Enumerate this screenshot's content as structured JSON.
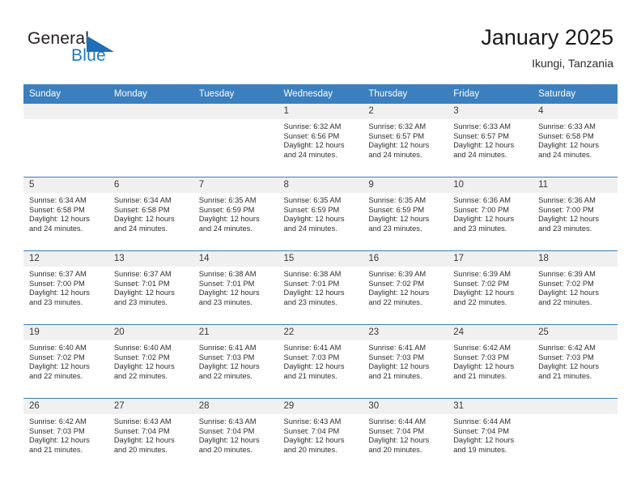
{
  "brand": {
    "name_part1": "General",
    "name_part2": "Blue",
    "triangle_color": "#1f6fb8",
    "blue_color": "#1f7ac4"
  },
  "header": {
    "title": "January 2025",
    "subtitle": "Ikungi, Tanzania"
  },
  "theme": {
    "header_row_bg": "#3b7fbf",
    "daynum_bg": "#f0f0f0",
    "grid_line": "#3b7fbf"
  },
  "weekdays": [
    "Sunday",
    "Monday",
    "Tuesday",
    "Wednesday",
    "Thursday",
    "Friday",
    "Saturday"
  ],
  "weeks": [
    [
      {
        "day": "",
        "sunrise": "",
        "sunset": "",
        "daylight": "",
        "daylight2": ""
      },
      {
        "day": "",
        "sunrise": "",
        "sunset": "",
        "daylight": "",
        "daylight2": ""
      },
      {
        "day": "",
        "sunrise": "",
        "sunset": "",
        "daylight": "",
        "daylight2": ""
      },
      {
        "day": "1",
        "sunrise": "Sunrise: 6:32 AM",
        "sunset": "Sunset: 6:56 PM",
        "daylight": "Daylight: 12 hours",
        "daylight2": "and 24 minutes."
      },
      {
        "day": "2",
        "sunrise": "Sunrise: 6:32 AM",
        "sunset": "Sunset: 6:57 PM",
        "daylight": "Daylight: 12 hours",
        "daylight2": "and 24 minutes."
      },
      {
        "day": "3",
        "sunrise": "Sunrise: 6:33 AM",
        "sunset": "Sunset: 6:57 PM",
        "daylight": "Daylight: 12 hours",
        "daylight2": "and 24 minutes."
      },
      {
        "day": "4",
        "sunrise": "Sunrise: 6:33 AM",
        "sunset": "Sunset: 6:58 PM",
        "daylight": "Daylight: 12 hours",
        "daylight2": "and 24 minutes."
      }
    ],
    [
      {
        "day": "5",
        "sunrise": "Sunrise: 6:34 AM",
        "sunset": "Sunset: 6:58 PM",
        "daylight": "Daylight: 12 hours",
        "daylight2": "and 24 minutes."
      },
      {
        "day": "6",
        "sunrise": "Sunrise: 6:34 AM",
        "sunset": "Sunset: 6:58 PM",
        "daylight": "Daylight: 12 hours",
        "daylight2": "and 24 minutes."
      },
      {
        "day": "7",
        "sunrise": "Sunrise: 6:35 AM",
        "sunset": "Sunset: 6:59 PM",
        "daylight": "Daylight: 12 hours",
        "daylight2": "and 24 minutes."
      },
      {
        "day": "8",
        "sunrise": "Sunrise: 6:35 AM",
        "sunset": "Sunset: 6:59 PM",
        "daylight": "Daylight: 12 hours",
        "daylight2": "and 24 minutes."
      },
      {
        "day": "9",
        "sunrise": "Sunrise: 6:35 AM",
        "sunset": "Sunset: 6:59 PM",
        "daylight": "Daylight: 12 hours",
        "daylight2": "and 23 minutes."
      },
      {
        "day": "10",
        "sunrise": "Sunrise: 6:36 AM",
        "sunset": "Sunset: 7:00 PM",
        "daylight": "Daylight: 12 hours",
        "daylight2": "and 23 minutes."
      },
      {
        "day": "11",
        "sunrise": "Sunrise: 6:36 AM",
        "sunset": "Sunset: 7:00 PM",
        "daylight": "Daylight: 12 hours",
        "daylight2": "and 23 minutes."
      }
    ],
    [
      {
        "day": "12",
        "sunrise": "Sunrise: 6:37 AM",
        "sunset": "Sunset: 7:00 PM",
        "daylight": "Daylight: 12 hours",
        "daylight2": "and 23 minutes."
      },
      {
        "day": "13",
        "sunrise": "Sunrise: 6:37 AM",
        "sunset": "Sunset: 7:01 PM",
        "daylight": "Daylight: 12 hours",
        "daylight2": "and 23 minutes."
      },
      {
        "day": "14",
        "sunrise": "Sunrise: 6:38 AM",
        "sunset": "Sunset: 7:01 PM",
        "daylight": "Daylight: 12 hours",
        "daylight2": "and 23 minutes."
      },
      {
        "day": "15",
        "sunrise": "Sunrise: 6:38 AM",
        "sunset": "Sunset: 7:01 PM",
        "daylight": "Daylight: 12 hours",
        "daylight2": "and 23 minutes."
      },
      {
        "day": "16",
        "sunrise": "Sunrise: 6:39 AM",
        "sunset": "Sunset: 7:02 PM",
        "daylight": "Daylight: 12 hours",
        "daylight2": "and 22 minutes."
      },
      {
        "day": "17",
        "sunrise": "Sunrise: 6:39 AM",
        "sunset": "Sunset: 7:02 PM",
        "daylight": "Daylight: 12 hours",
        "daylight2": "and 22 minutes."
      },
      {
        "day": "18",
        "sunrise": "Sunrise: 6:39 AM",
        "sunset": "Sunset: 7:02 PM",
        "daylight": "Daylight: 12 hours",
        "daylight2": "and 22 minutes."
      }
    ],
    [
      {
        "day": "19",
        "sunrise": "Sunrise: 6:40 AM",
        "sunset": "Sunset: 7:02 PM",
        "daylight": "Daylight: 12 hours",
        "daylight2": "and 22 minutes."
      },
      {
        "day": "20",
        "sunrise": "Sunrise: 6:40 AM",
        "sunset": "Sunset: 7:02 PM",
        "daylight": "Daylight: 12 hours",
        "daylight2": "and 22 minutes."
      },
      {
        "day": "21",
        "sunrise": "Sunrise: 6:41 AM",
        "sunset": "Sunset: 7:03 PM",
        "daylight": "Daylight: 12 hours",
        "daylight2": "and 22 minutes."
      },
      {
        "day": "22",
        "sunrise": "Sunrise: 6:41 AM",
        "sunset": "Sunset: 7:03 PM",
        "daylight": "Daylight: 12 hours",
        "daylight2": "and 21 minutes."
      },
      {
        "day": "23",
        "sunrise": "Sunrise: 6:41 AM",
        "sunset": "Sunset: 7:03 PM",
        "daylight": "Daylight: 12 hours",
        "daylight2": "and 21 minutes."
      },
      {
        "day": "24",
        "sunrise": "Sunrise: 6:42 AM",
        "sunset": "Sunset: 7:03 PM",
        "daylight": "Daylight: 12 hours",
        "daylight2": "and 21 minutes."
      },
      {
        "day": "25",
        "sunrise": "Sunrise: 6:42 AM",
        "sunset": "Sunset: 7:03 PM",
        "daylight": "Daylight: 12 hours",
        "daylight2": "and 21 minutes."
      }
    ],
    [
      {
        "day": "26",
        "sunrise": "Sunrise: 6:42 AM",
        "sunset": "Sunset: 7:03 PM",
        "daylight": "Daylight: 12 hours",
        "daylight2": "and 21 minutes."
      },
      {
        "day": "27",
        "sunrise": "Sunrise: 6:43 AM",
        "sunset": "Sunset: 7:04 PM",
        "daylight": "Daylight: 12 hours",
        "daylight2": "and 20 minutes."
      },
      {
        "day": "28",
        "sunrise": "Sunrise: 6:43 AM",
        "sunset": "Sunset: 7:04 PM",
        "daylight": "Daylight: 12 hours",
        "daylight2": "and 20 minutes."
      },
      {
        "day": "29",
        "sunrise": "Sunrise: 6:43 AM",
        "sunset": "Sunset: 7:04 PM",
        "daylight": "Daylight: 12 hours",
        "daylight2": "and 20 minutes."
      },
      {
        "day": "30",
        "sunrise": "Sunrise: 6:44 AM",
        "sunset": "Sunset: 7:04 PM",
        "daylight": "Daylight: 12 hours",
        "daylight2": "and 20 minutes."
      },
      {
        "day": "31",
        "sunrise": "Sunrise: 6:44 AM",
        "sunset": "Sunset: 7:04 PM",
        "daylight": "Daylight: 12 hours",
        "daylight2": "and 19 minutes."
      },
      {
        "day": "",
        "sunrise": "",
        "sunset": "",
        "daylight": "",
        "daylight2": ""
      }
    ]
  ]
}
